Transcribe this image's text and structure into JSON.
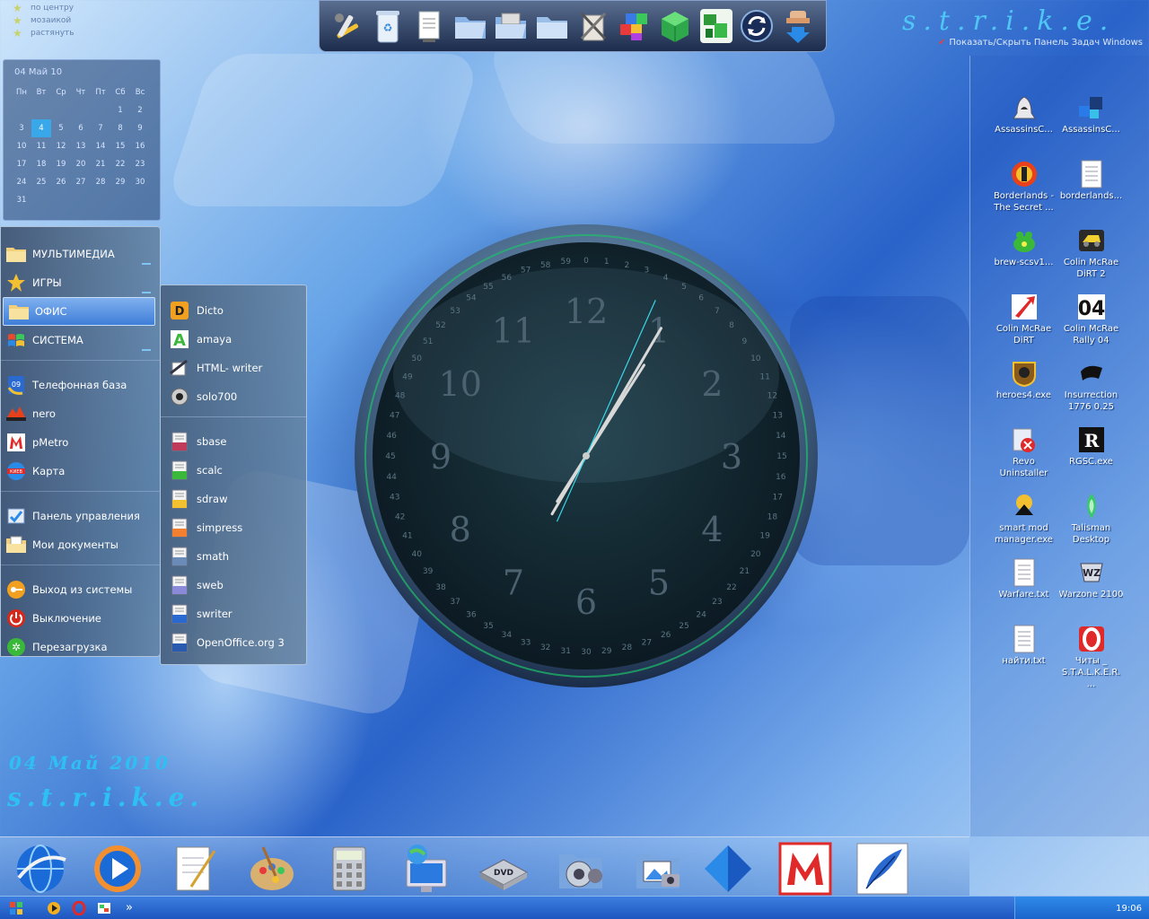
{
  "top_left_menu": {
    "items": [
      "по центру",
      "мозаикой",
      "растянуть"
    ]
  },
  "calendar": {
    "title": "04 Май 10",
    "weekdays": [
      "Пн",
      "Вт",
      "Ср",
      "Чт",
      "Пт",
      "Сб",
      "Вс"
    ],
    "weeks": [
      [
        "",
        "",
        "",
        "",
        "",
        "1",
        "2"
      ],
      [
        "3",
        "4",
        "5",
        "6",
        "7",
        "8",
        "9"
      ],
      [
        "10",
        "11",
        "12",
        "13",
        "14",
        "15",
        "16"
      ],
      [
        "17",
        "18",
        "19",
        "20",
        "21",
        "22",
        "23"
      ],
      [
        "24",
        "25",
        "26",
        "27",
        "28",
        "29",
        "30"
      ],
      [
        "31",
        "",
        "",
        "",
        "",
        "",
        ""
      ]
    ],
    "today": "4"
  },
  "brand": {
    "top": "s.t.r.i.k.e.",
    "taskbar_toggle": "Показать/Скрыть Панель Задач Windows"
  },
  "main_menu": {
    "groups": [
      [
        {
          "label": "МУЛЬТИМЕДИА",
          "icon": "folder-icon",
          "has_submenu": true
        },
        {
          "label": "ИГРЫ",
          "icon": "star-icon",
          "has_submenu": true
        },
        {
          "label": "ОФИС",
          "icon": "folder-icon",
          "has_submenu": true,
          "active": true
        },
        {
          "label": "СИСТЕМА",
          "icon": "windows-flag-icon",
          "has_submenu": true
        }
      ],
      [
        {
          "label": "Телефонная база",
          "icon": "phone-book-icon"
        },
        {
          "label": "nero",
          "icon": "nero-icon"
        },
        {
          "label": "pMetro",
          "icon": "metro-icon"
        },
        {
          "label": "Карта",
          "icon": "map-icon"
        }
      ],
      [
        {
          "label": "Панель управления",
          "icon": "control-panel-icon"
        },
        {
          "label": "Мои документы",
          "icon": "documents-folder-icon"
        }
      ],
      [
        {
          "label": "Выход из системы",
          "icon": "logoff-key-icon"
        },
        {
          "label": "Выключение",
          "icon": "power-icon"
        },
        {
          "label": "Перезагрузка",
          "icon": "restart-icon"
        }
      ]
    ]
  },
  "office_submenu": {
    "groups": [
      [
        {
          "label": "Dicto",
          "icon": "dicto-icon"
        },
        {
          "label": "amaya",
          "icon": "amaya-icon"
        },
        {
          "label": "HTML- writer",
          "icon": "html-writer-icon"
        },
        {
          "label": "solo700",
          "icon": "solo700-icon"
        }
      ],
      [
        {
          "label": "sbase",
          "icon": "sbase-icon"
        },
        {
          "label": "scalc",
          "icon": "scalc-icon"
        },
        {
          "label": "sdraw",
          "icon": "sdraw-icon"
        },
        {
          "label": "simpress",
          "icon": "simpress-icon"
        },
        {
          "label": "smath",
          "icon": "smath-icon"
        },
        {
          "label": "sweb",
          "icon": "sweb-icon"
        },
        {
          "label": "swriter",
          "icon": "swriter-icon"
        },
        {
          "label": "OpenOffice.org 3",
          "icon": "openoffice-icon"
        }
      ]
    ]
  },
  "top_toolbar": {
    "icons": [
      "tools-icon",
      "recycle-bin-icon",
      "document-icon",
      "folder-open-icon",
      "scanner-folder-icon",
      "folder-icon",
      "archive-tools-icon",
      "media-cubes-icon",
      "green-cube-icon",
      "network-computer-icon",
      "refresh-icon",
      "download-hand-icon"
    ]
  },
  "desktop_icons": [
    {
      "label": "AssassinsC...",
      "icon": "assassins-creed-icon"
    },
    {
      "label": "AssassinsC...",
      "icon": "assassins-creed-cubes-icon"
    },
    {
      "label": "Borderlands - The Secret ...",
      "icon": "borderlands-icon"
    },
    {
      "label": "borderlands...",
      "icon": "text-file-icon"
    },
    {
      "label": "brew-scsv1...",
      "icon": "brew-icon"
    },
    {
      "label": "Colin McRae DiRT 2",
      "icon": "dirt2-icon"
    },
    {
      "label": "Colin McRae DiRT",
      "icon": "dirt-icon"
    },
    {
      "label": "Colin McRae Rally 04",
      "icon": "rally04-icon"
    },
    {
      "label": "heroes4.exe",
      "icon": "heroes4-icon"
    },
    {
      "label": "Insurrection 1776 0.25",
      "icon": "insurrection-icon"
    },
    {
      "label": "Revo Uninstaller",
      "icon": "revo-uninstaller-icon"
    },
    {
      "label": "RGSC.exe",
      "icon": "rockstar-icon"
    },
    {
      "label": "smart mod manager.exe",
      "icon": "smart-mod-icon"
    },
    {
      "label": "Talisman Desktop",
      "icon": "talisman-icon"
    },
    {
      "label": "Warfare.txt",
      "icon": "text-file-icon"
    },
    {
      "label": "Warzone 2100",
      "icon": "warzone-icon"
    },
    {
      "label": "найти.txt",
      "icon": "text-file-icon"
    },
    {
      "label": "Читы _ S.T.A.L.K.E.R. ...",
      "icon": "opera-icon"
    }
  ],
  "clock": {
    "numerals": [
      "12",
      "1",
      "2",
      "3",
      "4",
      "5",
      "6",
      "7",
      "8",
      "9",
      "10",
      "11"
    ],
    "time_hour": 1,
    "time_minute": 5,
    "time_second": 4
  },
  "signature": {
    "date": "04 Май 2010",
    "brand": "s.t.r.i.k.e."
  },
  "dock": {
    "icons": [
      "browser-globe-icon",
      "media-player-icon",
      "notepad-icon",
      "paint-palette-icon",
      "calculator-icon",
      "network-monitor-icon",
      "dvd-drive-icon",
      "music-folder-icon",
      "pictures-folder-icon",
      "blue-pyramid-icon",
      "metro-icon",
      "feather-quill-icon"
    ]
  },
  "taskbar": {
    "quick_launch": [
      "windows-start-icon",
      "winamp-icon",
      "opera-icon",
      "media-icon",
      "more-chevron-icon"
    ],
    "time": "19:06",
    "more": "»"
  },
  "colors": {
    "accent": "#2ec0f4",
    "menu_active": "#3f7ed8",
    "taskbar": "#1d56bf",
    "calendar_today": "#39a8e8"
  }
}
